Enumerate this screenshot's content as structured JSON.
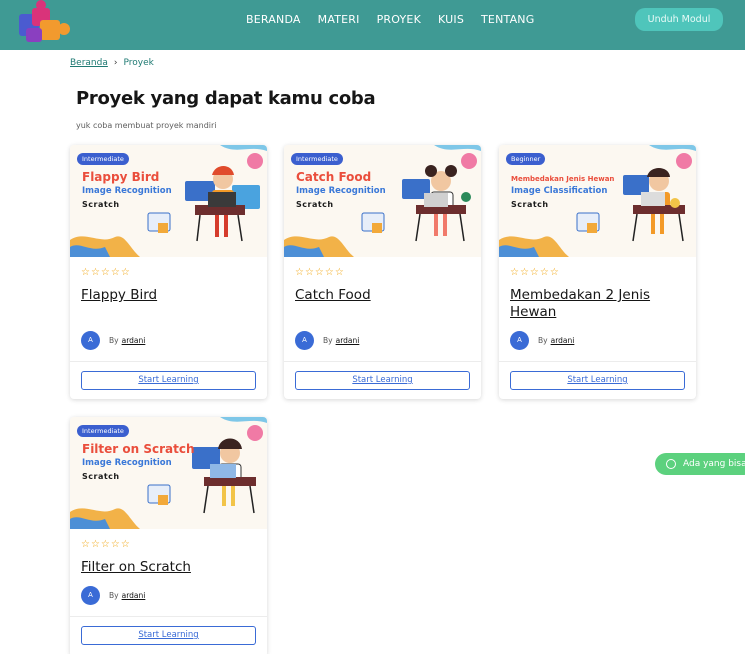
{
  "nav": {
    "items": [
      "BERANDA",
      "MATERI",
      "PROYEK",
      "KUIS",
      "TENTANG"
    ],
    "download_label": "Unduh Modul"
  },
  "breadcrumb": {
    "home": "Beranda",
    "current": "Proyek"
  },
  "page": {
    "title": "Proyek yang dapat kamu coba",
    "subtitle": "yuk coba membuat proyek mandiri"
  },
  "cards": [
    {
      "badge": "Intermediate",
      "thumb_title": "Flappy Bird",
      "thumb_subtitle": "Image Recognition",
      "thumb_tool": "Scratch",
      "title": "Flappy Bird",
      "stars": "☆☆☆☆☆",
      "avatar": "A",
      "by": "By",
      "author": "ardani",
      "button": "Start Learning"
    },
    {
      "badge": "Intermediate",
      "thumb_title": "Catch Food",
      "thumb_subtitle": "Image Recognition",
      "thumb_tool": "Scratch",
      "title": "Catch Food",
      "stars": "☆☆☆☆☆",
      "avatar": "A",
      "by": "By",
      "author": "ardani",
      "button": "Start Learning"
    },
    {
      "badge": "Beginner",
      "thumb_title": "Membedakan Jenis Hewan",
      "thumb_subtitle": "Image Classification",
      "thumb_tool": "Scratch",
      "title": "Membedakan 2 Jenis Hewan",
      "stars": "☆☆☆☆☆",
      "avatar": "A",
      "by": "By",
      "author": "ardani",
      "button": "Start Learning"
    },
    {
      "badge": "Intermediate",
      "thumb_title": "Filter on Scratch",
      "thumb_subtitle": "Image Recognition",
      "thumb_tool": "Scratch",
      "title": "Filter on Scratch",
      "stars": "☆☆☆☆☆",
      "avatar": "A",
      "by": "By",
      "author": "ardani",
      "button": "Start Learning"
    }
  ],
  "chat": {
    "label": "Ada yang bisa"
  },
  "colors": {
    "header": "#3f9a94",
    "download_button": "#4fc5bb",
    "accent_blue": "#3a6bd6",
    "thumb_title_red": "#ea4e3c",
    "star": "#f0a30a",
    "whatsapp": "#5cd17e"
  }
}
